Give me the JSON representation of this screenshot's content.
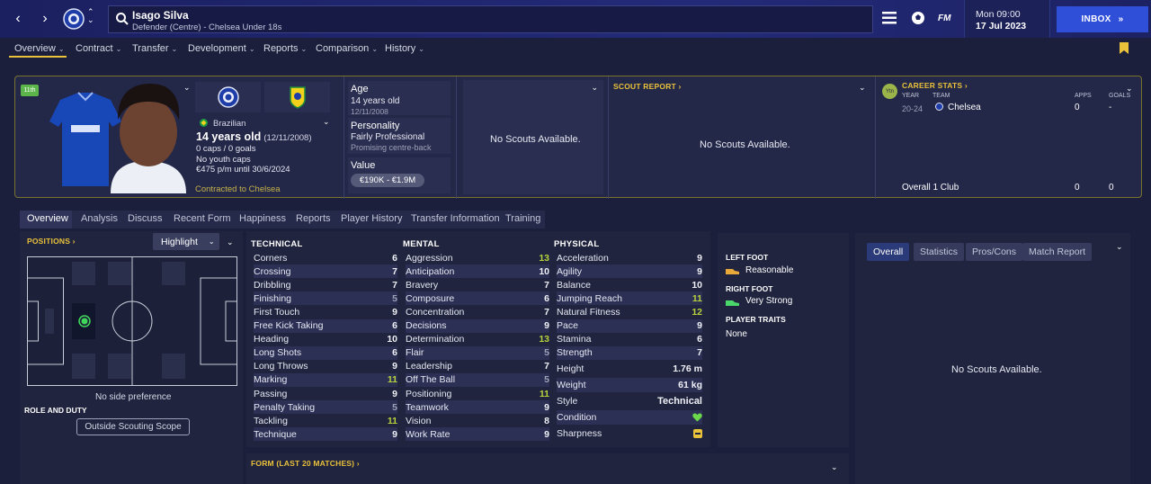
{
  "header": {
    "player_name": "Isago Silva",
    "player_subtitle": "Defender (Centre) - Chelsea Under 18s",
    "clock_day": "Mon 09:00",
    "clock_date": "17 Jul 2023",
    "inbox_label": "INBOX",
    "fm_label": "FM"
  },
  "nav": [
    "Overview",
    "Contract",
    "Transfer",
    "Development",
    "Reports",
    "Comparison",
    "History"
  ],
  "profile": {
    "nationality": "Brazilian",
    "age_main": "14 years old",
    "dob_paren": "(12/11/2008)",
    "caps": "0 caps / 0 goals",
    "youth_caps": "No youth caps",
    "wage": "€475 p/m until 30/6/2024",
    "contract_status": "Contracted to Chelsea",
    "shirt_badge": "11th",
    "age_label": "Age",
    "age_value": "14 years old",
    "dob": "12/11/2008",
    "personality_label": "Personality",
    "personality_value": "Fairly Professional",
    "personality_sub": "Promising centre-back",
    "value_label": "Value",
    "value_range": "€190K - €1.9M",
    "no_scouts_1": "No Scouts Available.",
    "scout_report_label": "SCOUT REPORT",
    "no_scouts_2": "No Scouts Available.",
    "career_stats_label": "CAREER STATS",
    "career_badge": "Ytn",
    "career_headers": {
      "year": "YEAR",
      "team": "TEAM",
      "apps": "APPS",
      "goals": "GOALS"
    },
    "career_row": {
      "year": "20-24",
      "team": "Chelsea",
      "apps": "0",
      "goals": "-"
    },
    "career_total": {
      "label": "Overall 1 Club",
      "apps": "0",
      "goals": "0"
    }
  },
  "tabs": [
    "Overview",
    "Analysis",
    "Discuss",
    "Recent Form",
    "Happiness",
    "Reports",
    "Player History",
    "Transfer Information",
    "Training"
  ],
  "positions": {
    "label": "POSITIONS",
    "highlight": "Highlight",
    "side_pref": "No side preference",
    "role_label": "ROLE AND DUTY",
    "scope_button": "Outside Scouting Scope"
  },
  "attributes": {
    "technical_label": "TECHNICAL",
    "mental_label": "MENTAL",
    "physical_label": "PHYSICAL",
    "technical": [
      {
        "name": "Corners",
        "value": "6"
      },
      {
        "name": "Crossing",
        "value": "7"
      },
      {
        "name": "Dribbling",
        "value": "7"
      },
      {
        "name": "Finishing",
        "value": "5"
      },
      {
        "name": "First Touch",
        "value": "9"
      },
      {
        "name": "Free Kick Taking",
        "value": "6"
      },
      {
        "name": "Heading",
        "value": "10"
      },
      {
        "name": "Long Shots",
        "value": "6"
      },
      {
        "name": "Long Throws",
        "value": "9"
      },
      {
        "name": "Marking",
        "value": "11"
      },
      {
        "name": "Passing",
        "value": "9"
      },
      {
        "name": "Penalty Taking",
        "value": "5"
      },
      {
        "name": "Tackling",
        "value": "11"
      },
      {
        "name": "Technique",
        "value": "9"
      }
    ],
    "mental": [
      {
        "name": "Aggression",
        "value": "13"
      },
      {
        "name": "Anticipation",
        "value": "10"
      },
      {
        "name": "Bravery",
        "value": "7"
      },
      {
        "name": "Composure",
        "value": "6"
      },
      {
        "name": "Concentration",
        "value": "7"
      },
      {
        "name": "Decisions",
        "value": "9"
      },
      {
        "name": "Determination",
        "value": "13"
      },
      {
        "name": "Flair",
        "value": "5"
      },
      {
        "name": "Leadership",
        "value": "7"
      },
      {
        "name": "Off The Ball",
        "value": "5"
      },
      {
        "name": "Positioning",
        "value": "11"
      },
      {
        "name": "Teamwork",
        "value": "9"
      },
      {
        "name": "Vision",
        "value": "8"
      },
      {
        "name": "Work Rate",
        "value": "9"
      }
    ],
    "physical": [
      {
        "name": "Acceleration",
        "value": "9"
      },
      {
        "name": "Agility",
        "value": "9"
      },
      {
        "name": "Balance",
        "value": "10"
      },
      {
        "name": "Jumping Reach",
        "value": "11"
      },
      {
        "name": "Natural Fitness",
        "value": "12"
      },
      {
        "name": "Pace",
        "value": "9"
      },
      {
        "name": "Stamina",
        "value": "6"
      },
      {
        "name": "Strength",
        "value": "7"
      }
    ],
    "height_label": "Height",
    "height": "1.76 m",
    "weight_label": "Weight",
    "weight": "61 kg",
    "style_label": "Style",
    "style": "Technical",
    "condition_label": "Condition",
    "sharpness_label": "Sharpness"
  },
  "feet": {
    "left_label": "LEFT FOOT",
    "left_value": "Reasonable",
    "right_label": "RIGHT FOOT",
    "right_value": "Very Strong",
    "traits_label": "PLAYER TRAITS",
    "traits_value": "None"
  },
  "form_label": "FORM (LAST 20 MATCHES)",
  "report_card": {
    "tabs": [
      "Overall",
      "Statistics",
      "Pros/Cons",
      "Match Report"
    ],
    "no_scouts": "No Scouts Available."
  },
  "colors": {
    "accent": "#e9c13a",
    "good": "#b8d23b",
    "inbox": "#2f4fd8"
  }
}
